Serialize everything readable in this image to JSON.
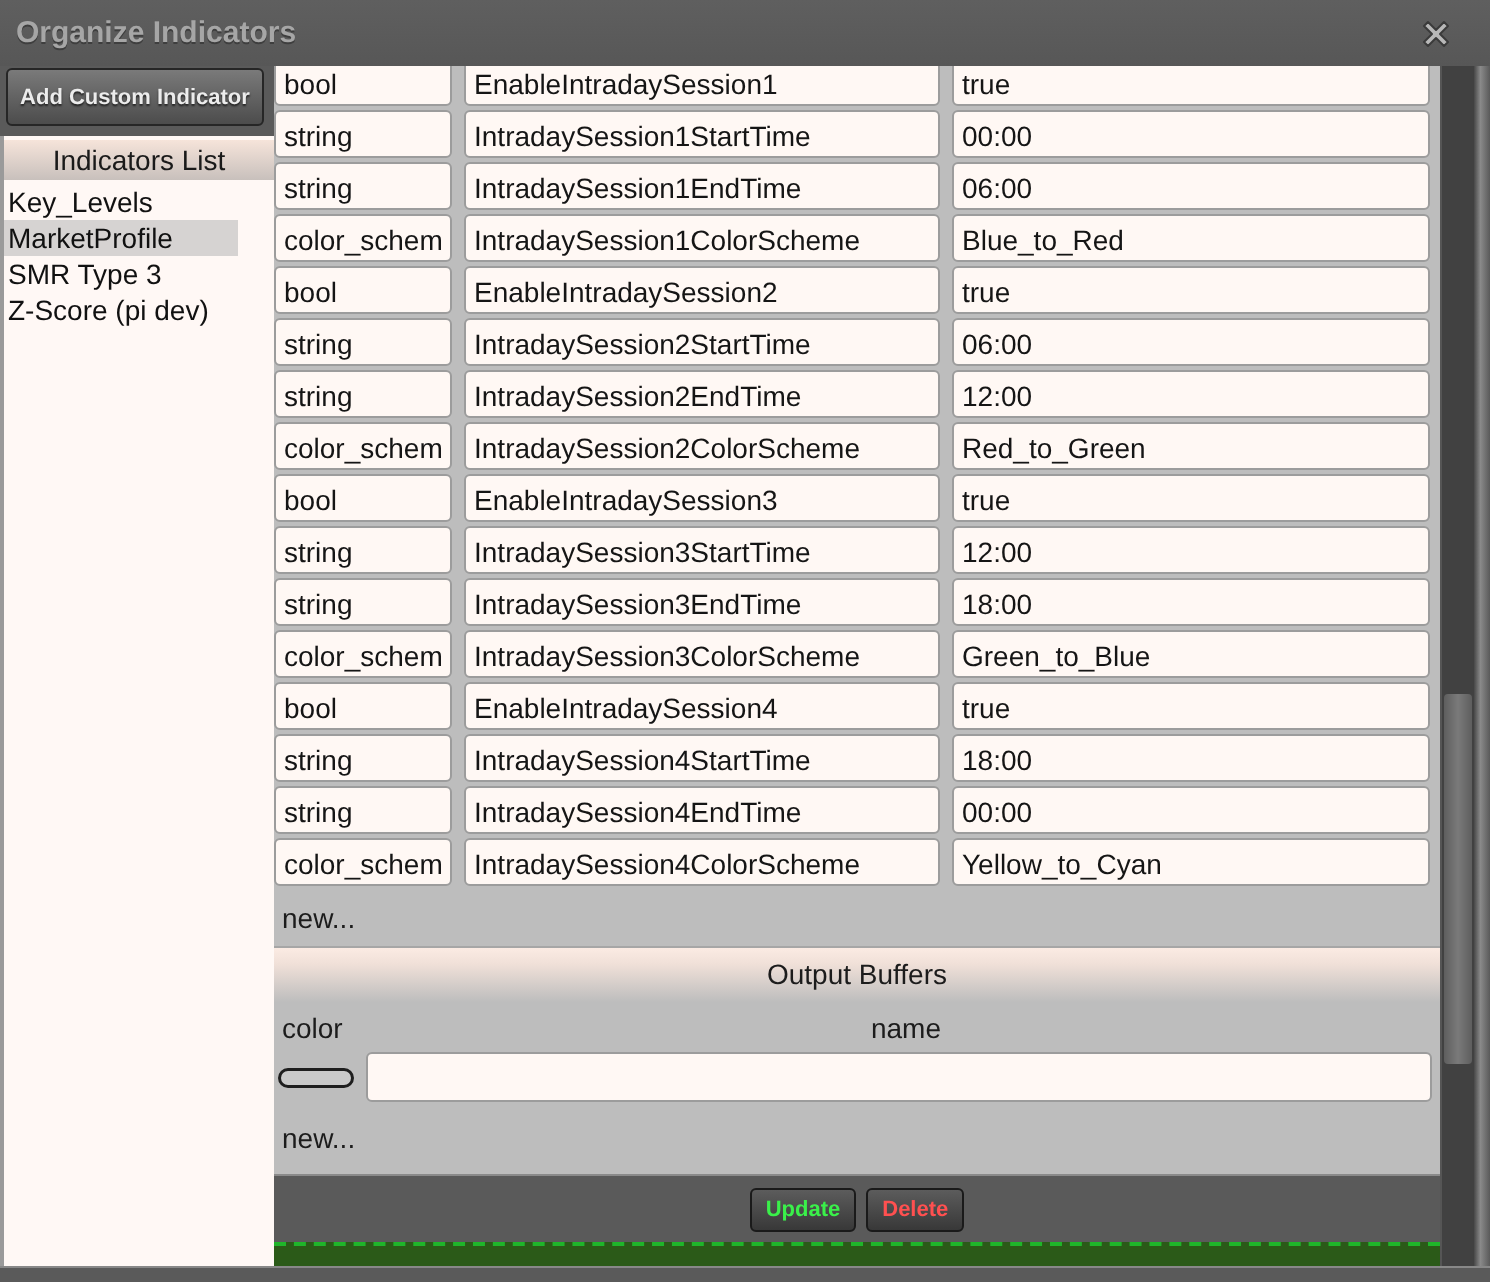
{
  "window": {
    "title": "Organize Indicators"
  },
  "sidebar": {
    "add_button": "Add Custom Indicator",
    "list_title": "Indicators List",
    "items": [
      {
        "label": "Key_Levels",
        "selected": false
      },
      {
        "label": "MarketProfile",
        "selected": true
      },
      {
        "label": "SMR Type 3",
        "selected": false
      },
      {
        "label": "Z-Score (pi dev)",
        "selected": false
      }
    ]
  },
  "parameters": {
    "rows": [
      {
        "type": "bool",
        "name": "EnableIntradaySession1",
        "value": "true"
      },
      {
        "type": "string",
        "name": "IntradaySession1StartTime",
        "value": "00:00"
      },
      {
        "type": "string",
        "name": "IntradaySession1EndTime",
        "value": "06:00"
      },
      {
        "type": "color_schem",
        "name": "IntradaySession1ColorScheme",
        "value": "Blue_to_Red"
      },
      {
        "type": "bool",
        "name": "EnableIntradaySession2",
        "value": "true"
      },
      {
        "type": "string",
        "name": "IntradaySession2StartTime",
        "value": "06:00"
      },
      {
        "type": "string",
        "name": "IntradaySession2EndTime",
        "value": "12:00"
      },
      {
        "type": "color_schem",
        "name": "IntradaySession2ColorScheme",
        "value": "Red_to_Green"
      },
      {
        "type": "bool",
        "name": "EnableIntradaySession3",
        "value": "true"
      },
      {
        "type": "string",
        "name": "IntradaySession3StartTime",
        "value": "12:00"
      },
      {
        "type": "string",
        "name": "IntradaySession3EndTime",
        "value": "18:00"
      },
      {
        "type": "color_schem",
        "name": "IntradaySession3ColorScheme",
        "value": "Green_to_Blue"
      },
      {
        "type": "bool",
        "name": "EnableIntradaySession4",
        "value": "true"
      },
      {
        "type": "string",
        "name": "IntradaySession4StartTime",
        "value": "18:00"
      },
      {
        "type": "string",
        "name": "IntradaySession4EndTime",
        "value": "00:00"
      },
      {
        "type": "color_schem",
        "name": "IntradaySession4ColorScheme",
        "value": "Yellow_to_Cyan"
      }
    ],
    "new_link": "new..."
  },
  "output_buffers": {
    "title": "Output Buffers",
    "columns": [
      "color",
      "name"
    ],
    "new_link": "new..."
  },
  "actions": [
    {
      "label": "Update",
      "kind": "update"
    },
    {
      "label": "Delete",
      "kind": "delete"
    }
  ]
}
